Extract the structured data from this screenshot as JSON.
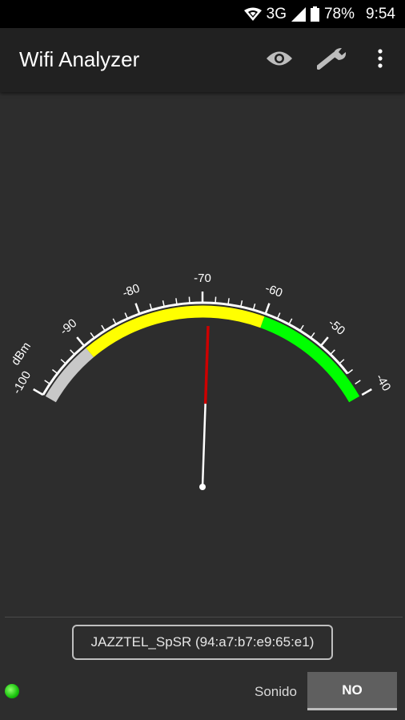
{
  "status_bar": {
    "network_type": "3G",
    "battery_percent": "78%",
    "time": "9:54",
    "icons": [
      "wifi-icon",
      "signal-icon",
      "battery-icon"
    ]
  },
  "app_bar": {
    "title": "Wifi Analyzer",
    "actions": [
      "eye-icon",
      "wrench-icon",
      "overflow-menu-icon"
    ]
  },
  "gauge": {
    "unit_label": "dBm",
    "min_dbm": -100,
    "max_dbm": -40,
    "current_dbm": -69,
    "tick_labels": [
      "-100",
      "-90",
      "-80",
      "-70",
      "-60",
      "-50",
      "-40"
    ],
    "zones": [
      {
        "from": -100,
        "to": -90,
        "color": "#c8c8c8"
      },
      {
        "from": -90,
        "to": -60,
        "color": "#ffff00"
      },
      {
        "from": -60,
        "to": -40,
        "color": "#00ff00"
      }
    ],
    "needle_tip_color": "#cc0000",
    "needle_color": "#ffffff"
  },
  "network": {
    "label": "JAZZTEL_SpSR (94:a7:b7:e9:65:e1)"
  },
  "footer": {
    "sound_label": "Sonido",
    "sound_toggle_value": "NO",
    "indicator_color": "#17c10b"
  }
}
